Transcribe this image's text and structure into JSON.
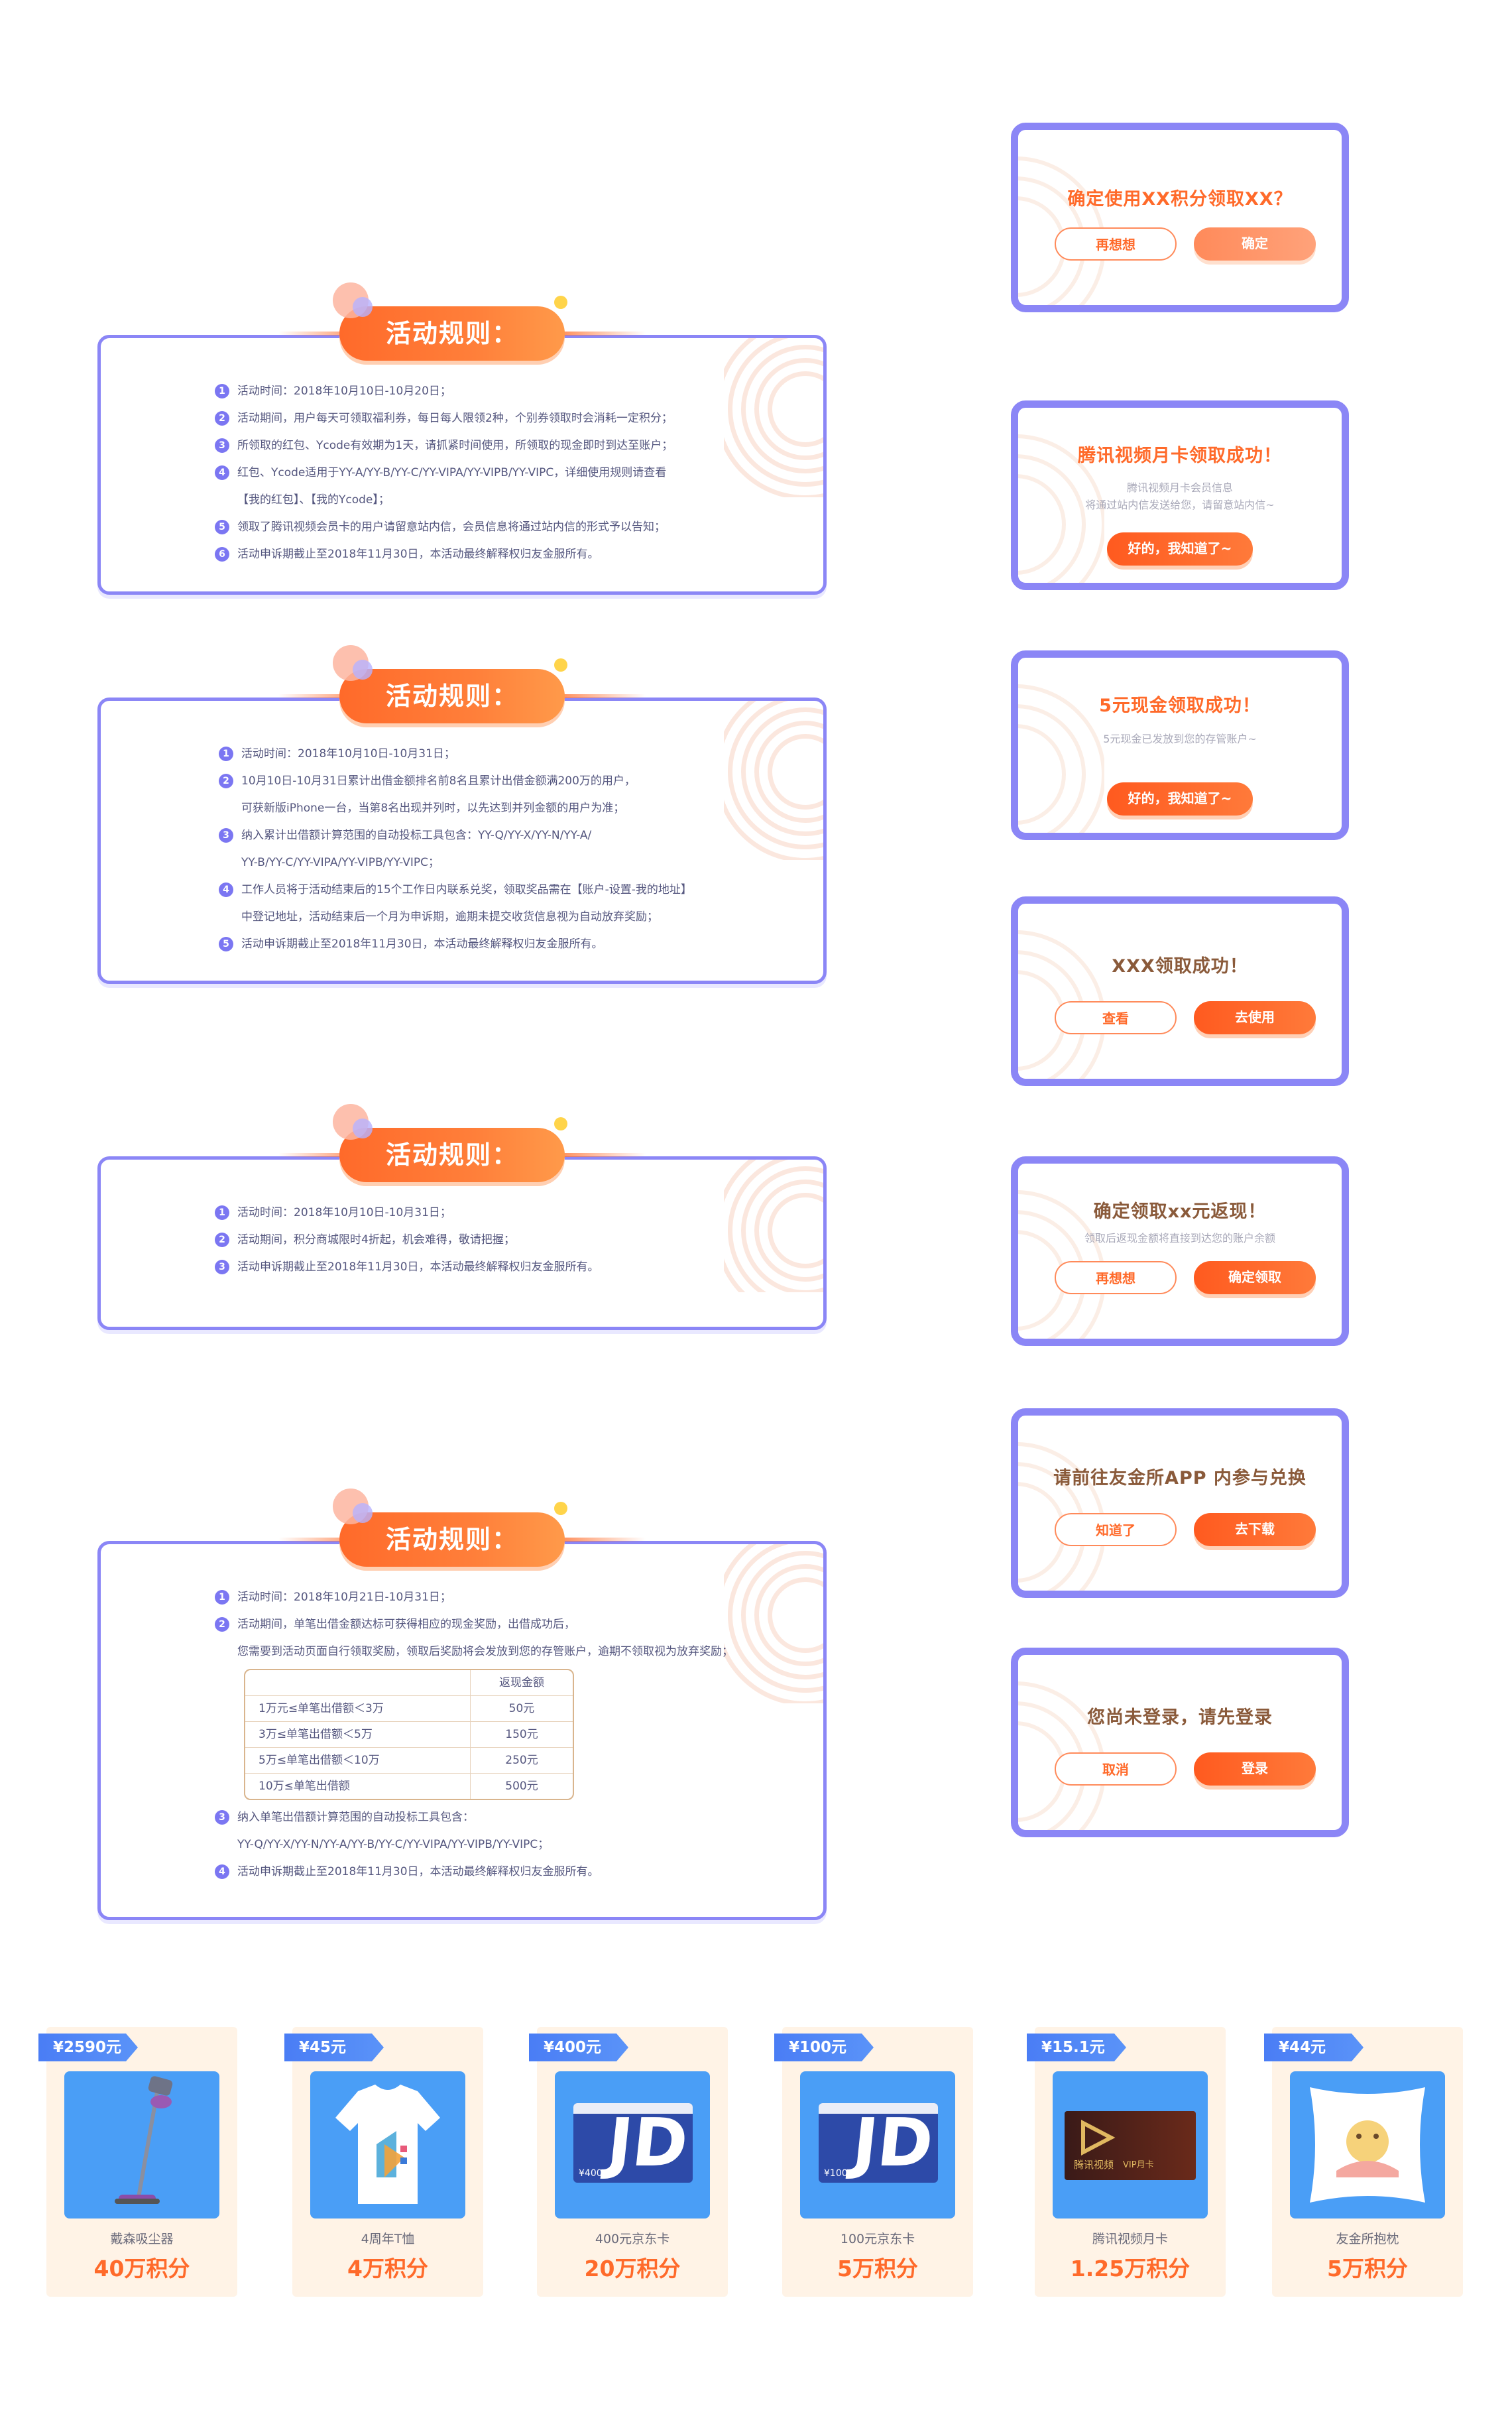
{
  "rules_title": "活动规则：",
  "panel1": {
    "items": [
      {
        "n": "1",
        "text": "活动时间：2018年10月10日-10月20日；"
      },
      {
        "n": "2",
        "text": "活动期间，用户每天可领取福利券，每日每人限领2种，个别券领取时会消耗一定积分；"
      },
      {
        "n": "3",
        "text": "所领取的红包、Ycode有效期为1天，请抓紧时间使用，所领取的现金即时到达至账户；"
      },
      {
        "n": "4",
        "text": "红包、Ycode适用于YY-A/YY-B/YY-C/YY-VIPA/YY-VIPB/YY-VIPC，详细使用规则请查看"
      },
      {
        "n": "",
        "text": "【我的红包】、【我的Ycode】；"
      },
      {
        "n": "5",
        "text": "领取了腾讯视频会员卡的用户请留意站内信，会员信息将通过站内信的形式予以告知；"
      },
      {
        "n": "6",
        "text": "活动申诉期截止至2018年11月30日，本活动最终解释权归友金服所有。"
      }
    ]
  },
  "panel2": {
    "items": [
      {
        "n": "1",
        "text": "活动时间：2018年10月10日-10月31日；"
      },
      {
        "n": "2",
        "text": "10月10日-10月31日累计出借金额排名前8名且累计出借金额满200万的用户，"
      },
      {
        "n": "",
        "text": "可获新版iPhone一台，当第8名出现并列时，以先达到并列金额的用户为准；"
      },
      {
        "n": "3",
        "text": "纳入累计出借额计算范围的自动投标工具包含：YY-Q/YY-X/YY-N/YY-A/"
      },
      {
        "n": "",
        "text": "YY-B/YY-C/YY-VIPA/YY-VIPB/YY-VIPC；"
      },
      {
        "n": "4",
        "text": "工作人员将于活动结束后的15个工作日内联系兑奖，领取奖品需在【账户-设置-我的地址】"
      },
      {
        "n": "",
        "text": "中登记地址，活动结束后一个月为申诉期，逾期未提交收货信息视为自动放弃奖励；"
      },
      {
        "n": "5",
        "text": "活动申诉期截止至2018年11月30日，本活动最终解释权归友金服所有。"
      }
    ]
  },
  "panel3": {
    "items": [
      {
        "n": "1",
        "text": "活动时间：2018年10月10日-10月31日；"
      },
      {
        "n": "2",
        "text": "活动期间，积分商城限时4折起，机会难得，敬请把握；"
      },
      {
        "n": "3",
        "text": "活动申诉期截止至2018年11月30日，本活动最终解释权归友金服所有。"
      }
    ]
  },
  "panel4": {
    "items_top": [
      {
        "n": "1",
        "text": "活动时间：2018年10月21日-10月31日；"
      },
      {
        "n": "2",
        "text": "活动期间，单笔出借金额达标可获得相应的现金奖励，出借成功后，"
      },
      {
        "n": "",
        "text": "您需要到活动页面自行领取奖励，领取后奖励将会发放到您的存管账户，逾期不领取视为放弃奖励；"
      }
    ],
    "table": {
      "header": [
        "",
        "返现金额"
      ],
      "rows": [
        [
          "1万元≤单笔出借额＜3万",
          "50元"
        ],
        [
          "3万≤单笔出借额＜5万",
          "150元"
        ],
        [
          "5万≤单笔出借额＜10万",
          "250元"
        ],
        [
          "10万≤单笔出借额",
          "500元"
        ]
      ]
    },
    "items_bottom": [
      {
        "n": "3",
        "text": "纳入单笔出借额计算范围的自动投标工具包含："
      },
      {
        "n": "",
        "text": "YY-Q/YY-X/YY-N/YY-A/YY-B/YY-C/YY-VIPA/YY-VIPB/YY-VIPC；"
      },
      {
        "n": "4",
        "text": "活动申诉期截止至2018年11月30日，本活动最终解释权归友金服所有。"
      }
    ]
  },
  "dialogs": [
    {
      "title": "确定使用XX积分领取XX？",
      "buttons": [
        "再想想",
        "确定"
      ]
    },
    {
      "title": "腾讯视频月卡领取成功！",
      "sub1": "腾讯视频月卡会员信息",
      "sub2": "将通过站内信发送给您，请留意站内信~",
      "buttons": [
        "好的，我知道了~"
      ]
    },
    {
      "title": "5元现金领取成功！",
      "sub1": "5元现金已发放到您的存管账户~",
      "buttons": [
        "好的，我知道了~"
      ]
    },
    {
      "title": "XXX领取成功！",
      "buttons": [
        "查看",
        "去使用"
      ]
    },
    {
      "title": "确定领取xx元返现！",
      "sub1": "领取后返现金额将直接到达您的账户余额",
      "buttons": [
        "再想想",
        "确定领取"
      ]
    },
    {
      "title": "请前往友金所APP 内参与兑换",
      "buttons": [
        "知道了",
        "去下载"
      ]
    },
    {
      "title": "您尚未登录，请先登录",
      "buttons": [
        "取消",
        "登录"
      ]
    }
  ],
  "prizes": [
    {
      "price": "¥2590元",
      "name": "戴森吸尘器",
      "points": "40万积分"
    },
    {
      "price": "¥45元",
      "name": "4周年T恤",
      "points": "4万积分"
    },
    {
      "price": "¥400元",
      "name": "400元京东卡",
      "points": "20万积分",
      "card_value": "¥400",
      "card_logo": "JD"
    },
    {
      "price": "¥100元",
      "name": "100元京东卡",
      "points": "5万积分",
      "card_value": "¥100",
      "card_logo": "JD"
    },
    {
      "price": "¥15.1元",
      "name": "腾讯视频月卡",
      "points": "1.25万积分",
      "card_text": "腾讯视频",
      "card_text2": "VIP月卡"
    },
    {
      "price": "¥44元",
      "name": "友金所抱枕",
      "points": "5万积分"
    }
  ],
  "colors": {
    "accent": "#ff6a2a",
    "frame": "#8b86f6",
    "tag": "#4a7df5",
    "card_bg": "#fff3e6"
  }
}
